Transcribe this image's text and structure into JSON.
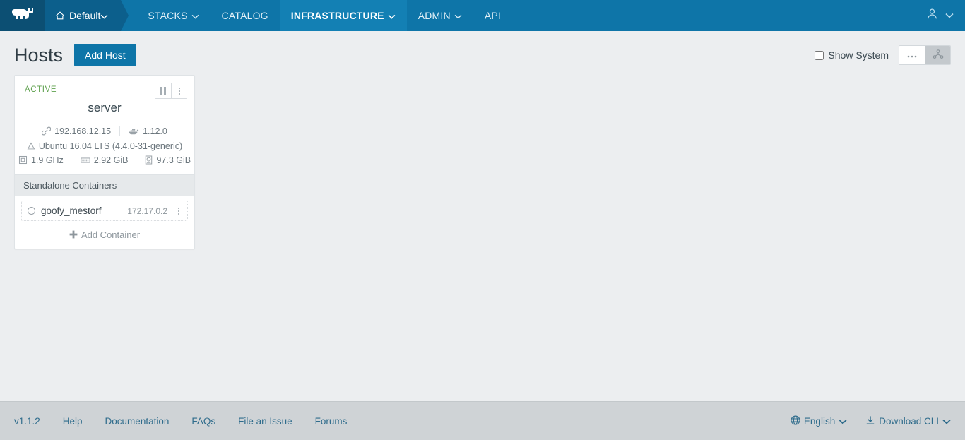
{
  "navbar": {
    "logo_icon": "rancher-cow-logo",
    "environment": {
      "label": "Default",
      "icon": "home-icon",
      "caret": "chevron-down-icon"
    },
    "items": [
      {
        "label": "STACKS",
        "has_caret": true,
        "active": false
      },
      {
        "label": "CATALOG",
        "has_caret": false,
        "active": false
      },
      {
        "label": "INFRASTRUCTURE",
        "has_caret": true,
        "active": true
      },
      {
        "label": "ADMIN",
        "has_caret": true,
        "active": false
      },
      {
        "label": "API",
        "has_caret": false,
        "active": false
      }
    ],
    "user": {
      "icon": "user-avatar-icon",
      "caret": "chevron-down-icon"
    },
    "bg_color": "#0e75a8",
    "logo_bg_color": "#0c4f73",
    "env_bg_color": "#0c5f8c",
    "active_bg_color": "#1380b4"
  },
  "page_header": {
    "title": "Hosts",
    "add_host_label": "Add Host",
    "show_system_label": "Show System",
    "show_system_checked": false,
    "view_dots_icon": "ellipsis-icon",
    "view_graph_icon": "cluster-graph-icon",
    "accent_color": "#0e75a8"
  },
  "host": {
    "state": "ACTIVE",
    "state_color": "#5fa14e",
    "name": "server",
    "pause_icon": "pause-icon",
    "menu_icon": "vertical-dots-icon",
    "ip_icon": "link-icon",
    "ip": "192.168.12.15",
    "docker_icon": "docker-whale-icon",
    "docker_version": "1.12.0",
    "os_icon": "ubuntu-icon",
    "os": "Ubuntu 16.04 LTS (4.4.0-31-generic)",
    "cpu_icon": "cpu-icon",
    "cpu": "1.9 GHz",
    "memory_icon": "memory-icon",
    "memory": "2.92 GiB",
    "disk_icon": "disk-icon",
    "disk": "97.3 GiB"
  },
  "containers": {
    "section_title": "Standalone Containers",
    "items": [
      {
        "state_icon": "circle-state-icon",
        "name": "goofy_mestorf",
        "ip": "172.17.0.2",
        "menu_icon": "vertical-dots-icon"
      }
    ],
    "add_label": "Add Container",
    "add_icon": "plus-icon"
  },
  "footer": {
    "links": [
      {
        "label": "v1.1.2"
      },
      {
        "label": "Help"
      },
      {
        "label": "Documentation"
      },
      {
        "label": "FAQs"
      },
      {
        "label": "File an Issue"
      },
      {
        "label": "Forums"
      }
    ],
    "language": {
      "label": "English",
      "icon": "globe-icon",
      "caret": "chevron-down-icon"
    },
    "download_cli": {
      "label": "Download CLI",
      "icon": "download-icon",
      "caret": "chevron-down-icon"
    },
    "bg_color": "#cfd3d6",
    "link_color": "#2f6c8c"
  }
}
